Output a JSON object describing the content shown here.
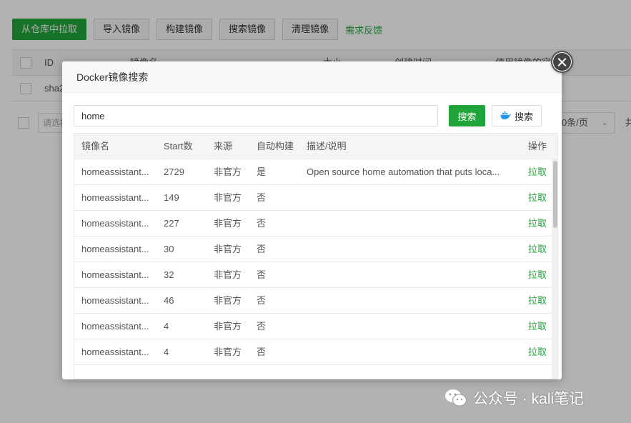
{
  "toolbar": {
    "pull_label": "从仓库中拉取",
    "import_label": "导入镜像",
    "build_label": "构建镜像",
    "search_label": "搜索镜像",
    "clean_label": "清理镜像",
    "feedback_label": "需求反馈"
  },
  "bg_table": {
    "headers": [
      "ID",
      "镜像名",
      "大小",
      "创建时间",
      "使用镜像的容器"
    ],
    "row_id": "sha2"
  },
  "bg_footer": {
    "select_placeholder": "请选择",
    "page_size": "0条/页",
    "total_prefix": "共"
  },
  "modal": {
    "title": "Docker镜像搜索",
    "search_value": "home",
    "search_button": "搜索",
    "docker_search_button": "搜索",
    "columns": [
      "镜像名",
      "Start数",
      "来源",
      "自动构建",
      "描述/说明",
      "操作"
    ],
    "rows": [
      {
        "name": "homeassistant...",
        "stars": "2729",
        "source": "非官方",
        "auto": "是",
        "desc": "Open source home automation that puts loca...",
        "op": "拉取"
      },
      {
        "name": "homeassistant...",
        "stars": "149",
        "source": "非官方",
        "auto": "否",
        "desc": "",
        "op": "拉取"
      },
      {
        "name": "homeassistant...",
        "stars": "227",
        "source": "非官方",
        "auto": "否",
        "desc": "",
        "op": "拉取"
      },
      {
        "name": "homeassistant...",
        "stars": "30",
        "source": "非官方",
        "auto": "否",
        "desc": "",
        "op": "拉取"
      },
      {
        "name": "homeassistant...",
        "stars": "32",
        "source": "非官方",
        "auto": "否",
        "desc": "",
        "op": "拉取"
      },
      {
        "name": "homeassistant...",
        "stars": "46",
        "source": "非官方",
        "auto": "否",
        "desc": "",
        "op": "拉取"
      },
      {
        "name": "homeassistant...",
        "stars": "4",
        "source": "非官方",
        "auto": "否",
        "desc": "",
        "op": "拉取"
      },
      {
        "name": "homeassistant...",
        "stars": "4",
        "source": "非官方",
        "auto": "否",
        "desc": "",
        "op": "拉取"
      }
    ]
  },
  "watermark": {
    "text": "公众号 · kali笔记"
  },
  "colors": {
    "accent": "#20a53a",
    "docker_blue": "#2496ed"
  }
}
